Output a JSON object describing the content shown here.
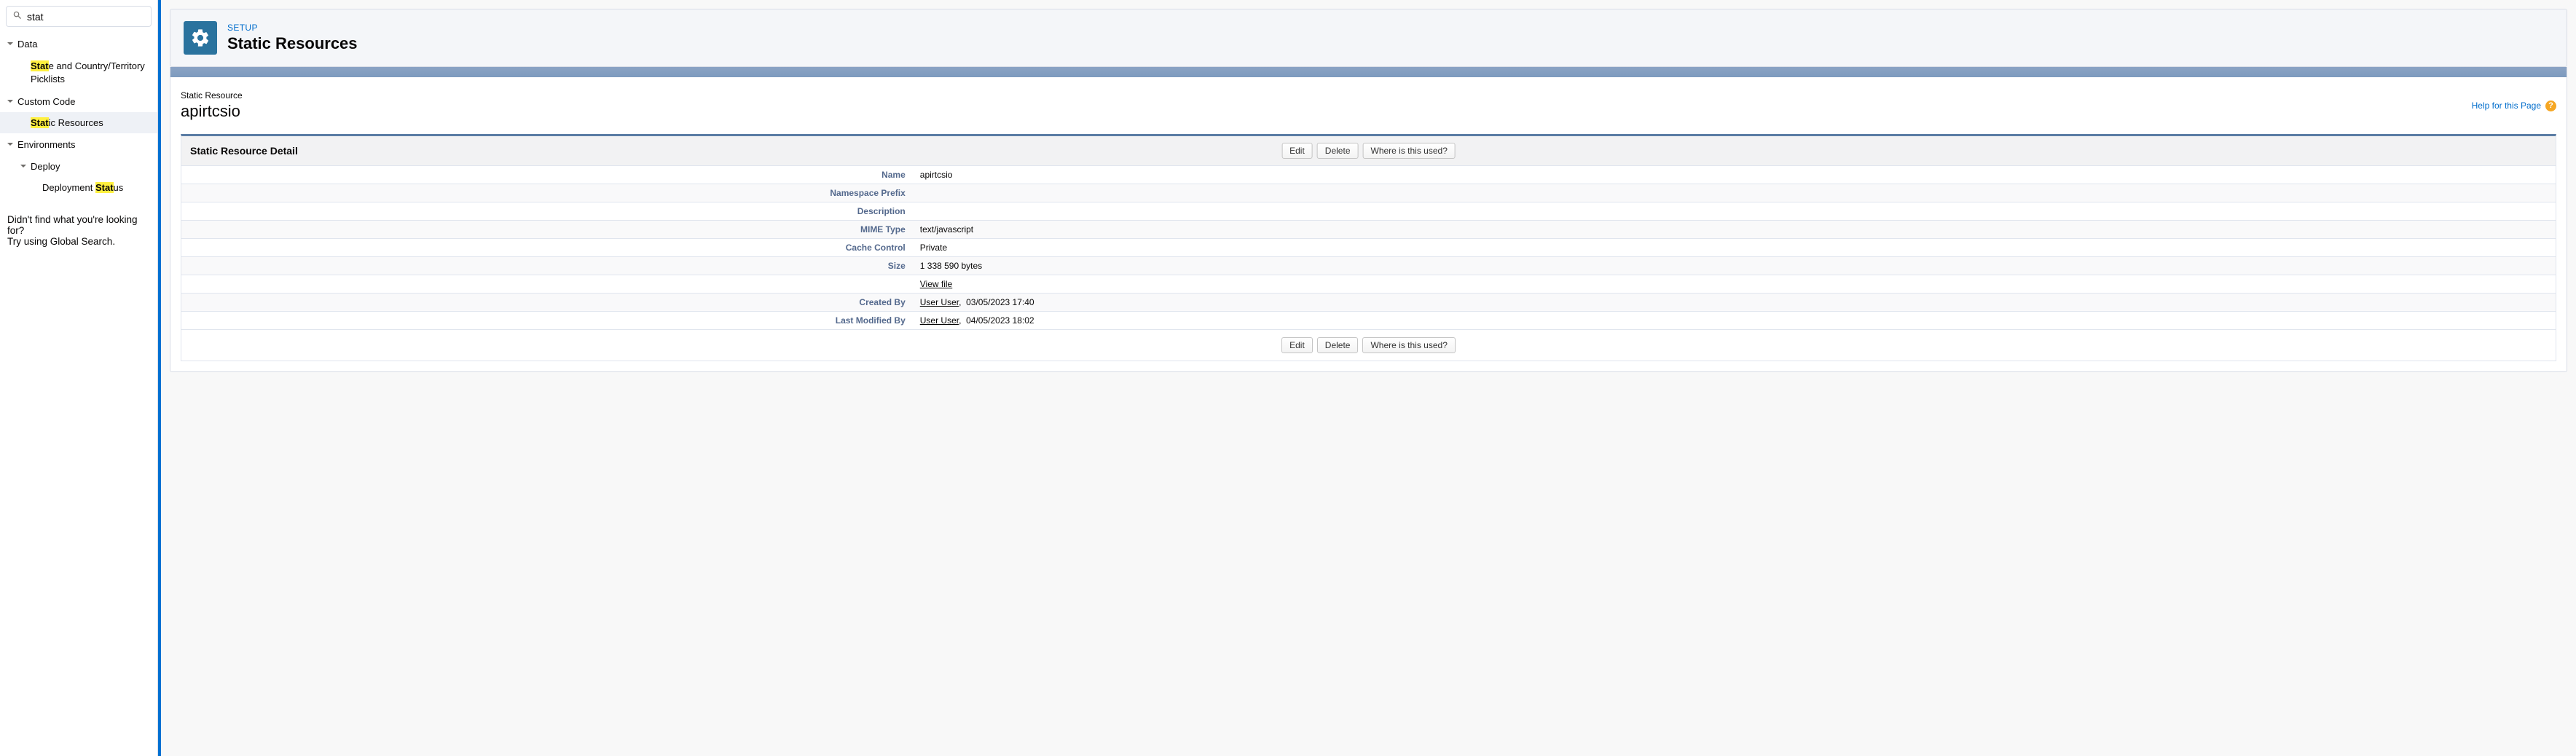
{
  "sidebar": {
    "search_value": "stat",
    "groups": [
      {
        "label": "Data",
        "items": [
          {
            "label_pre": "Stat",
            "label_post": "e and Country/Territory Picklists",
            "selected": false,
            "indent": 1
          }
        ]
      },
      {
        "label": "Custom Code",
        "items": [
          {
            "label_pre": "Stat",
            "label_post": "ic Resources",
            "selected": true,
            "indent": 1
          }
        ]
      },
      {
        "label": "Environments",
        "subgroup": {
          "label": "Deploy",
          "items": [
            {
              "label_pre0": "Deployment ",
              "label_pre": "Stat",
              "label_post": "us",
              "selected": false,
              "indent": 2
            }
          ]
        }
      }
    ],
    "nofind": "Didn't find what you're looking for?",
    "tryglobal": "Try using Global Search."
  },
  "header": {
    "eyebrow": "SETUP",
    "title": "Static Resources"
  },
  "object": {
    "crumb": "Static Resource",
    "name": "apirtcsio",
    "help_label": "Help for this Page"
  },
  "detail": {
    "title": "Static Resource Detail",
    "buttons": {
      "edit": "Edit",
      "delete": "Delete",
      "whereused": "Where is this used?"
    },
    "fields": {
      "name_label": "Name",
      "name_value": "apirtcsio",
      "ns_label": "Namespace Prefix",
      "ns_value": "",
      "desc_label": "Description",
      "desc_value": "",
      "mime_label": "MIME Type",
      "mime_value": "text/javascript",
      "cache_label": "Cache Control",
      "cache_value": "Private",
      "size_label": "Size",
      "size_value": "1 338 590 bytes",
      "viewfile_label": "",
      "viewfile_link": "View file",
      "created_label": "Created By",
      "created_user": "User User",
      "created_time": "03/05/2023 17:40",
      "modified_label": "Last Modified By",
      "modified_user": "User User",
      "modified_time": "04/05/2023 18:02"
    }
  }
}
